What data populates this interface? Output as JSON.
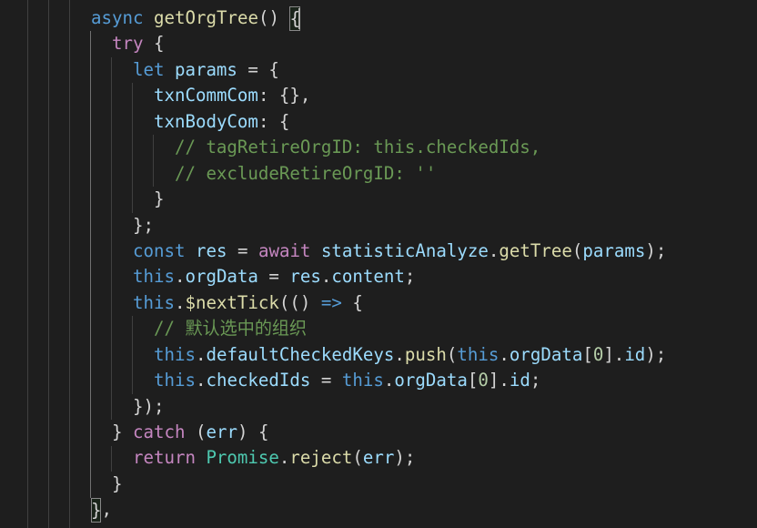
{
  "editor": {
    "theme": {
      "background": "#1e1e1e",
      "keyword": "#569cd6",
      "control": "#c586c0",
      "function": "#dcdcaa",
      "variable": "#9cdcfe",
      "class": "#4ec9b0",
      "comment": "#6a9955",
      "number": "#b5cea8",
      "punctuation": "#d4d4d4",
      "indent_guide": "#404040",
      "active_indent_guide": "#707070",
      "bracket_match_border": "#888888",
      "cursor": "#aeafad"
    },
    "lines": [
      {
        "tokens": [
          "async ",
          "getOrgTree",
          "() ",
          "{"
        ]
      },
      {
        "tokens": [
          "try ",
          "{"
        ]
      },
      {
        "tokens": [
          "let ",
          "params",
          " = {"
        ]
      },
      {
        "tokens": [
          "txnCommCom",
          ": {},"
        ]
      },
      {
        "tokens": [
          "txnBodyCom",
          ": {"
        ]
      },
      {
        "tokens": [
          "// tagRetireOrgID: this.checkedIds,"
        ]
      },
      {
        "tokens": [
          "// excludeRetireOrgID: ''"
        ]
      },
      {
        "tokens": [
          "}"
        ]
      },
      {
        "tokens": [
          "};"
        ]
      },
      {
        "tokens": [
          "const ",
          "res",
          " = ",
          "await ",
          "statisticAnalyze",
          ".",
          "getTree",
          "(",
          "params",
          ");"
        ]
      },
      {
        "tokens": [
          "this",
          ".",
          "orgData",
          " = ",
          "res",
          ".",
          "content",
          ";"
        ]
      },
      {
        "tokens": [
          "this",
          ".",
          "$nextTick",
          "(() ",
          "=>",
          " {"
        ]
      },
      {
        "tokens": [
          "// 默认选中的组织"
        ]
      },
      {
        "tokens": [
          "this",
          ".",
          "defaultCheckedKeys",
          ".",
          "push",
          "(",
          "this",
          ".",
          "orgData",
          "[",
          "0",
          "].",
          "id",
          ");"
        ]
      },
      {
        "tokens": [
          "this",
          ".",
          "checkedIds",
          " = ",
          "this",
          ".",
          "orgData",
          "[",
          "0",
          "].",
          "id",
          ";"
        ]
      },
      {
        "tokens": [
          "});"
        ]
      },
      {
        "tokens": [
          "} ",
          "catch ",
          "(",
          "err",
          ") {"
        ]
      },
      {
        "tokens": [
          "return ",
          "Promise",
          ".",
          "reject",
          "(",
          "err",
          ");"
        ]
      },
      {
        "tokens": [
          "}"
        ]
      },
      {
        "tokens": [
          "}",
          ","
        ]
      }
    ]
  }
}
